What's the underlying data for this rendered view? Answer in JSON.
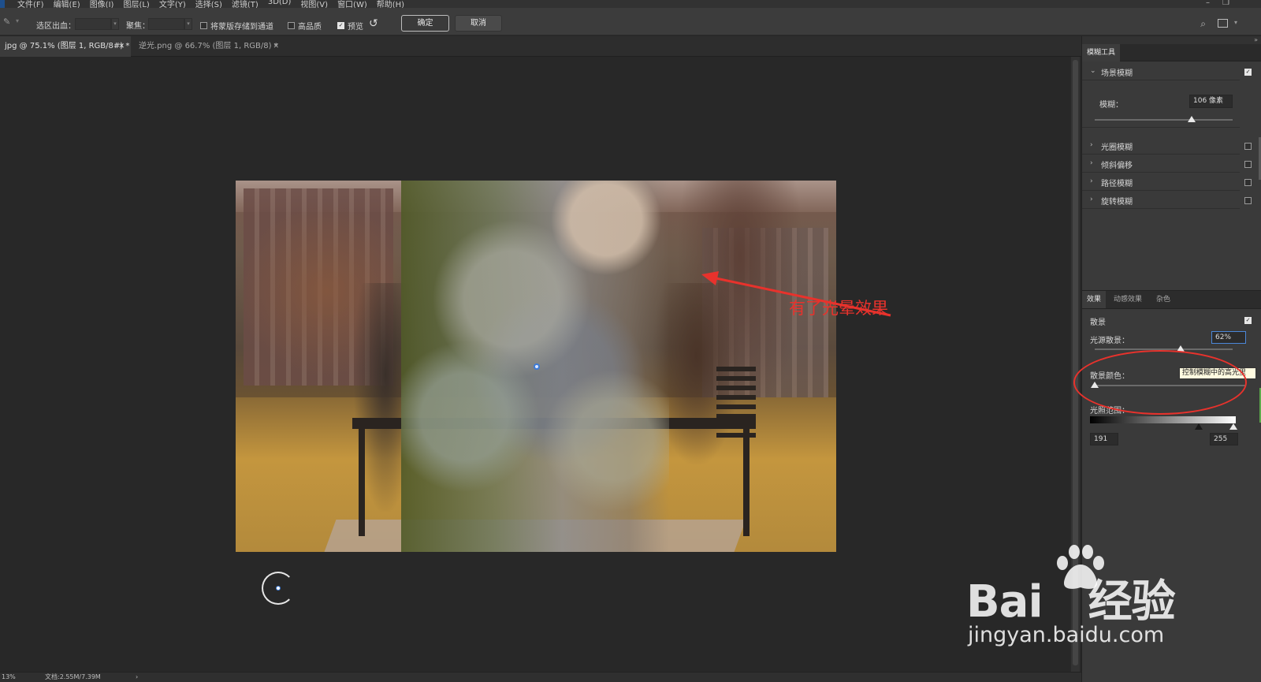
{
  "menu": {
    "items": [
      "文件(F)",
      "编辑(E)",
      "图像(I)",
      "图层(L)",
      "文字(Y)",
      "选择(S)",
      "滤镜(T)",
      "3D(D)",
      "视图(V)",
      "窗口(W)",
      "帮助(H)"
    ]
  },
  "options": {
    "selection_bleed_label": "选区出血：",
    "focus_label": "聚焦：",
    "save_mask_label": "将蒙版存储到通道",
    "high_quality_label": "高品质",
    "preview_label": "预览",
    "preview_checked": true,
    "ok_label": "确定",
    "cancel_label": "取消"
  },
  "tabs": [
    {
      "title": "jpg @ 75.1% (图层 1, RGB/8#) *",
      "active": true
    },
    {
      "title": "逆光.png @ 66.7% (图层 1, RGB/8) *",
      "active": false
    }
  ],
  "annotation": {
    "text": "有了光晕效果",
    "color": "#e8322c"
  },
  "status": {
    "zoom": "13%",
    "doc": "文档:2.55M/7.39M"
  },
  "blur_tools": {
    "panel_title": "模糊工具",
    "scene_blur": {
      "label": "场景模糊",
      "checked": true,
      "blur_label": "模糊：",
      "blur_value": "106 像素",
      "slider_fraction": 0.7
    },
    "others": [
      {
        "label": "光圈模糊",
        "checked": false
      },
      {
        "label": "倾斜偏移",
        "checked": false
      },
      {
        "label": "路径模糊",
        "checked": false
      },
      {
        "label": "旋转模糊",
        "checked": false
      }
    ]
  },
  "effects": {
    "tabs": [
      "效果",
      "动感效果",
      "杂色"
    ],
    "bokeh_label": "散景",
    "bokeh_checked": true,
    "light_bokeh_label": "光源散景：",
    "light_bokeh_value": "62%",
    "light_bokeh_fraction": 0.62,
    "bokeh_color_label": "散景颜色：",
    "bokeh_color_fraction": 0.0,
    "tooltip": "控制模糊中的高光里",
    "light_range_label": "光照范围：",
    "range_low": "191",
    "range_high": "255"
  },
  "watermark": {
    "brand_left": "Bai",
    "brand_right": "经验",
    "url": "jingyan.baidu.com"
  },
  "colors": {
    "accent_blue": "#3b7bd8",
    "annotation_red": "#e8322c"
  }
}
